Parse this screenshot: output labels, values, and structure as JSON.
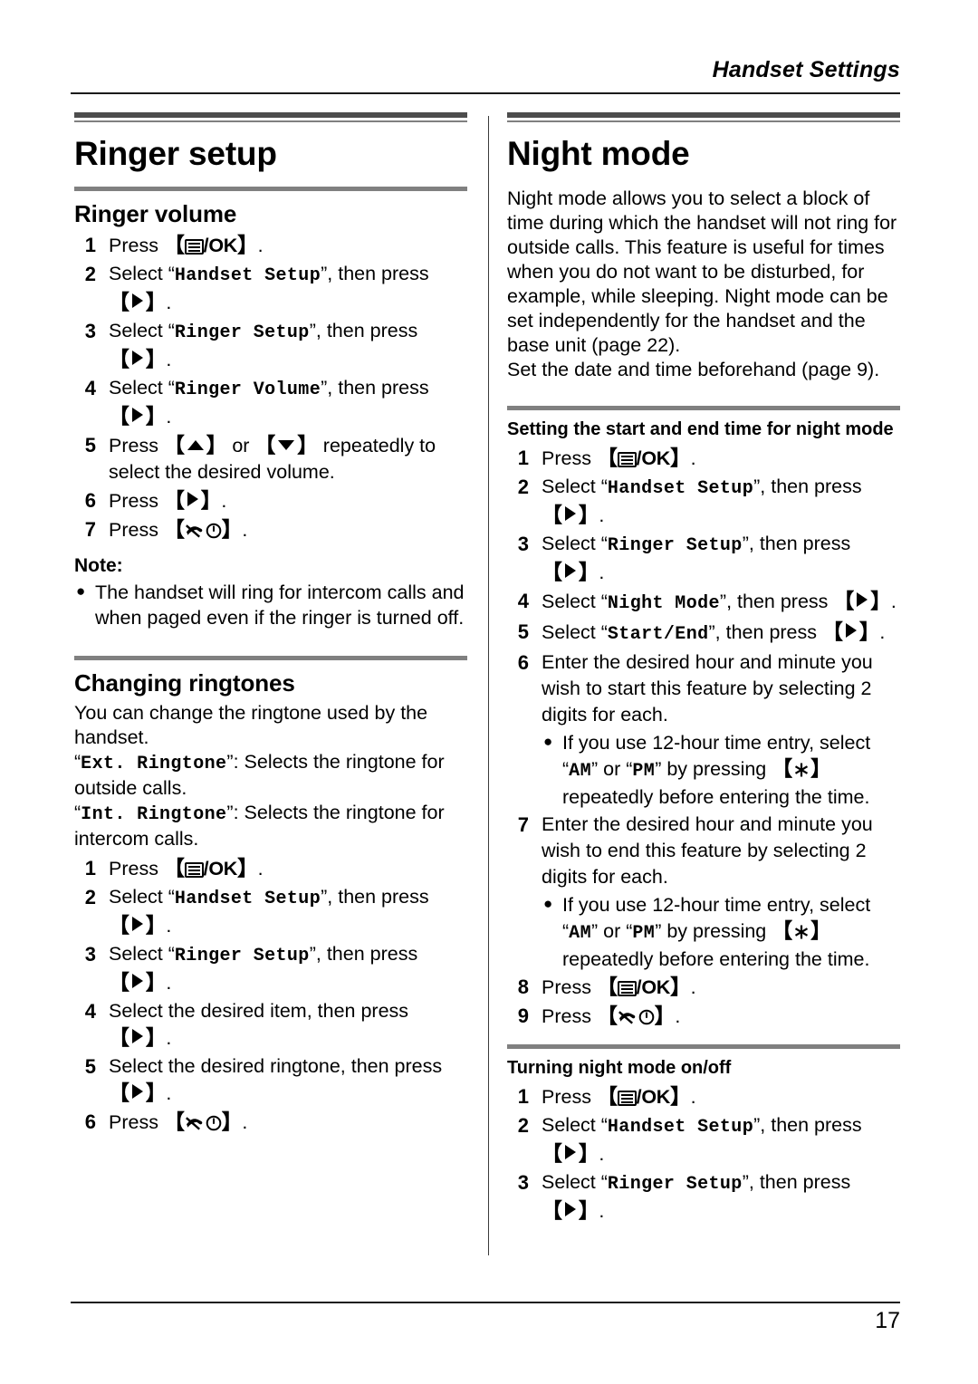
{
  "header": {
    "running_head": "Handset Settings"
  },
  "footer": {
    "page_number": "17"
  },
  "icons": {
    "menu": "menu-ok-icon",
    "arrow_right": "arrow-right-icon",
    "arrow_up": "arrow-up-icon",
    "arrow_down": "arrow-down-icon",
    "offhook": "offhook-power-icon",
    "star": "star-key-icon",
    "bullet": "●"
  },
  "keys": {
    "ok_label": "/OK",
    "bracket_open": "【",
    "bracket_close": "】"
  },
  "left_column": {
    "section_title": "Ringer setup",
    "ringer_volume": {
      "title": "Ringer volume",
      "steps": [
        {
          "num": "1",
          "pre": "Press ",
          "key": "menu_ok",
          "post": "."
        },
        {
          "num": "2",
          "pre": "Select “",
          "lcd": "Handset Setup",
          "mid": "”, then press ",
          "key": "right",
          "post": "."
        },
        {
          "num": "3",
          "pre": "Select “",
          "lcd": "Ringer Setup",
          "mid": "”, then press ",
          "key": "right",
          "post": "."
        },
        {
          "num": "4",
          "pre": "Select “",
          "lcd": "Ringer Volume",
          "mid": "”, then press ",
          "key": "right",
          "post": "."
        },
        {
          "num": "5",
          "pre": "Press ",
          "key": "up_or_down",
          "mid": " or ",
          "post": " repeatedly to select the desired volume."
        },
        {
          "num": "6",
          "pre": "Press ",
          "key": "right",
          "post": "."
        },
        {
          "num": "7",
          "pre": "Press ",
          "key": "offhook",
          "post": "."
        }
      ],
      "note_label": "Note:",
      "note_items": [
        "The handset will ring for intercom calls and when paged even if the ringer is turned off."
      ]
    },
    "changing_ringtones": {
      "title": "Changing ringtones",
      "intro": "You can change the ringtone used by the handset.",
      "ext_ringtone_name": "Ext. Ringtone",
      "ext_ringtone_desc": ": Selects the ringtone for outside calls.",
      "int_ringtone_name": "Int. Ringtone",
      "int_ringtone_desc": ": Selects the ringtone for intercom calls.",
      "steps": [
        {
          "num": "1",
          "pre": "Press ",
          "key": "menu_ok",
          "post": "."
        },
        {
          "num": "2",
          "pre": "Select “",
          "lcd": "Handset Setup",
          "mid": "”, then press ",
          "key": "right",
          "post": "."
        },
        {
          "num": "3",
          "pre": "Select “",
          "lcd": "Ringer Setup",
          "mid": "”, then press ",
          "key": "right",
          "post": "."
        },
        {
          "num": "4",
          "pre": "Select the desired item, then press ",
          "key": "right",
          "post": "."
        },
        {
          "num": "5",
          "pre": "Select the desired ringtone, then press ",
          "key": "right",
          "post": "."
        },
        {
          "num": "6",
          "pre": "Press ",
          "key": "offhook",
          "post": "."
        }
      ]
    }
  },
  "right_column": {
    "section_title": "Night mode",
    "intro_paragraph": "Night mode allows you to select a block of time during which the handset will not ring for outside calls. This feature is useful for times when you do not want to be disturbed, for example, while sleeping. Night mode can be set independently for the handset and the base unit (page 22).",
    "intro_paragraph_2": "Set the date and time beforehand (page 9).",
    "start_end": {
      "title": "Setting the start and end time for night mode",
      "steps": [
        {
          "num": "1",
          "pre": "Press ",
          "key": "menu_ok",
          "post": "."
        },
        {
          "num": "2",
          "pre": "Select “",
          "lcd": "Handset Setup",
          "mid": "”, then press ",
          "key": "right",
          "post": "."
        },
        {
          "num": "3",
          "pre": "Select “",
          "lcd": "Ringer Setup",
          "mid": "”, then press ",
          "key": "right",
          "post": "."
        },
        {
          "num": "4",
          "pre": "Select “",
          "lcd": "Night Mode",
          "mid": "”, then press ",
          "key": "right",
          "post": "."
        },
        {
          "num": "5",
          "pre": "Select “",
          "lcd": "Start/End",
          "mid": "”, then press ",
          "key": "right",
          "post": "."
        },
        {
          "num": "6",
          "pre": "Enter the desired hour and minute you wish to start this feature by selecting 2 digits for each.",
          "key": "none",
          "post": ""
        },
        {
          "num": "7",
          "pre": "Enter the desired hour and minute you wish to end this feature by selecting 2 digits for each.",
          "key": "none",
          "post": ""
        },
        {
          "num": "8",
          "pre": "Press ",
          "key": "menu_ok",
          "post": "."
        },
        {
          "num": "9",
          "pre": "Press ",
          "key": "offhook",
          "post": "."
        }
      ],
      "ampm_bullet_pre": "If you use 12-hour time entry, select “",
      "ampm_am": "AM",
      "ampm_mid": "” or “",
      "ampm_pm": "PM",
      "ampm_post": "” by pressing ",
      "ampm_tail": " repeatedly before entering the time."
    },
    "on_off": {
      "title": "Turning night mode on/off",
      "steps": [
        {
          "num": "1",
          "pre": "Press ",
          "key": "menu_ok",
          "post": "."
        },
        {
          "num": "2",
          "pre": "Select “",
          "lcd": "Handset Setup",
          "mid": "”, then press ",
          "key": "right",
          "post": "."
        },
        {
          "num": "3",
          "pre": "Select “",
          "lcd": "Ringer Setup",
          "mid": "”, then press ",
          "key": "right",
          "post": "."
        }
      ]
    }
  }
}
